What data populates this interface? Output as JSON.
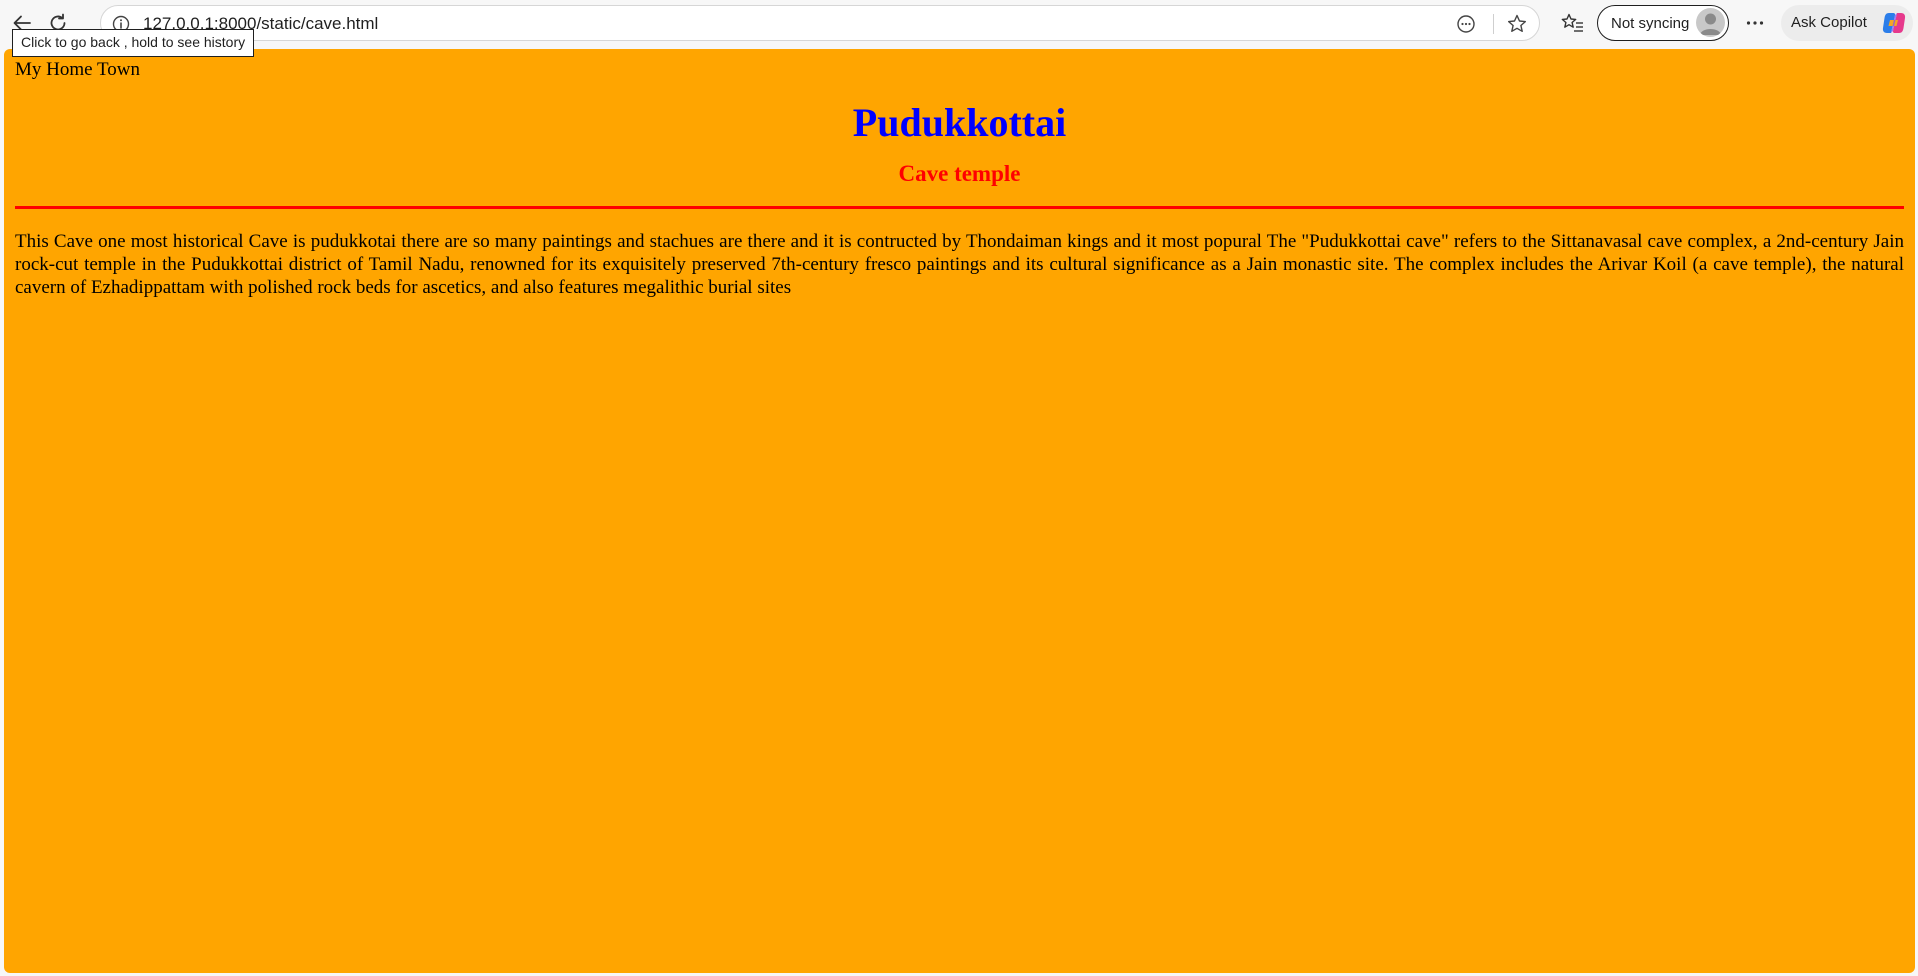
{
  "browser": {
    "url": "127.0.0.1:8000/static/cave.html",
    "tooltip": "Click to go back , hold to see history",
    "sync_label": "Not syncing",
    "copilot_label": "Ask Copilot",
    "icons": [
      "back-arrow-icon",
      "refresh-icon",
      "info-icon",
      "read-aloud-icon",
      "favorite-star-icon",
      "favorites-list-icon",
      "profile-avatar-icon",
      "more-options-icon",
      "copilot-logo-icon"
    ]
  },
  "page": {
    "site_label": "My Home Town",
    "title": "Pudukkottai",
    "subtitle": "Cave temple",
    "body": "This Cave one most historical Cave is pudukkotai there are so many paintings and stachues are there and it is contructed by Thondaiman kings and it most popural The \"Pudukkottai cave\" refers to the Sittanavasal cave complex, a 2nd-century Jain rock-cut temple in the Pudukkottai district of Tamil Nadu, renowned for its exquisitely preserved 7th-century fresco paintings and its cultural significance as a Jain monastic site. The complex includes the Arivar Koil (a cave temple), the natural cavern of Ezhadippattam with polished rock beds for ascetics, and also features megalithic burial sites"
  },
  "colors": {
    "page_background": "#ffa500",
    "title": "#0000ff",
    "subtitle": "#ff0000",
    "rule": "#ff0000",
    "text": "#000000"
  }
}
